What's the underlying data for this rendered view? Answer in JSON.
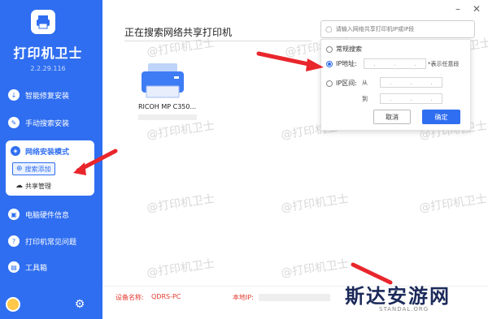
{
  "app": {
    "name": "打印机卫士",
    "version": "2.2.29.116"
  },
  "sidebar": {
    "items": [
      {
        "label": "智能修复安装",
        "icon": "repair-icon"
      },
      {
        "label": "手动搜索安装",
        "icon": "wrench-icon"
      }
    ],
    "group": {
      "label": "网络安装模式",
      "icon": "network-icon",
      "sub_items": [
        {
          "label": "搜索添加",
          "icon": "search-icon",
          "active": true
        },
        {
          "label": "共享管理",
          "icon": "cloud-icon",
          "active": false
        }
      ]
    },
    "bottom_items": [
      {
        "label": "电脑硬件信息",
        "icon": "hardware-icon"
      },
      {
        "label": "打印机常见问题",
        "icon": "question-icon"
      },
      {
        "label": "工具箱",
        "icon": "toolbox-icon"
      }
    ]
  },
  "main": {
    "title": "正在搜索网络共享打印机",
    "printer": {
      "name": "RICOH MP C350..."
    }
  },
  "search": {
    "placeholder": "请输入网络共享打印机IP或IP段"
  },
  "popup": {
    "options": [
      {
        "label": "常规搜索",
        "selected": false
      },
      {
        "label": "IP地址:",
        "selected": true
      },
      {
        "label": "IP区间:",
        "selected": false
      }
    ],
    "ip_hint": "*表示任意段",
    "from_label": "从",
    "to_label": "到",
    "ip_dots": ".",
    "cancel_label": "取消",
    "confirm_label": "确定"
  },
  "footer": {
    "device_label": "设备名称:",
    "device_value": "QDRS-PC",
    "ip_label": "本地IP:"
  },
  "watermark": "@打印机卫士",
  "window": {
    "minimize": "–",
    "close": "✕"
  },
  "overlay": {
    "brand": "斯达安游网",
    "brand_sub": "STANDAL.ORG"
  },
  "colors": {
    "primary": "#2f6ef0",
    "accent_red": "#e23a2e",
    "arrow": "#e8262c"
  }
}
